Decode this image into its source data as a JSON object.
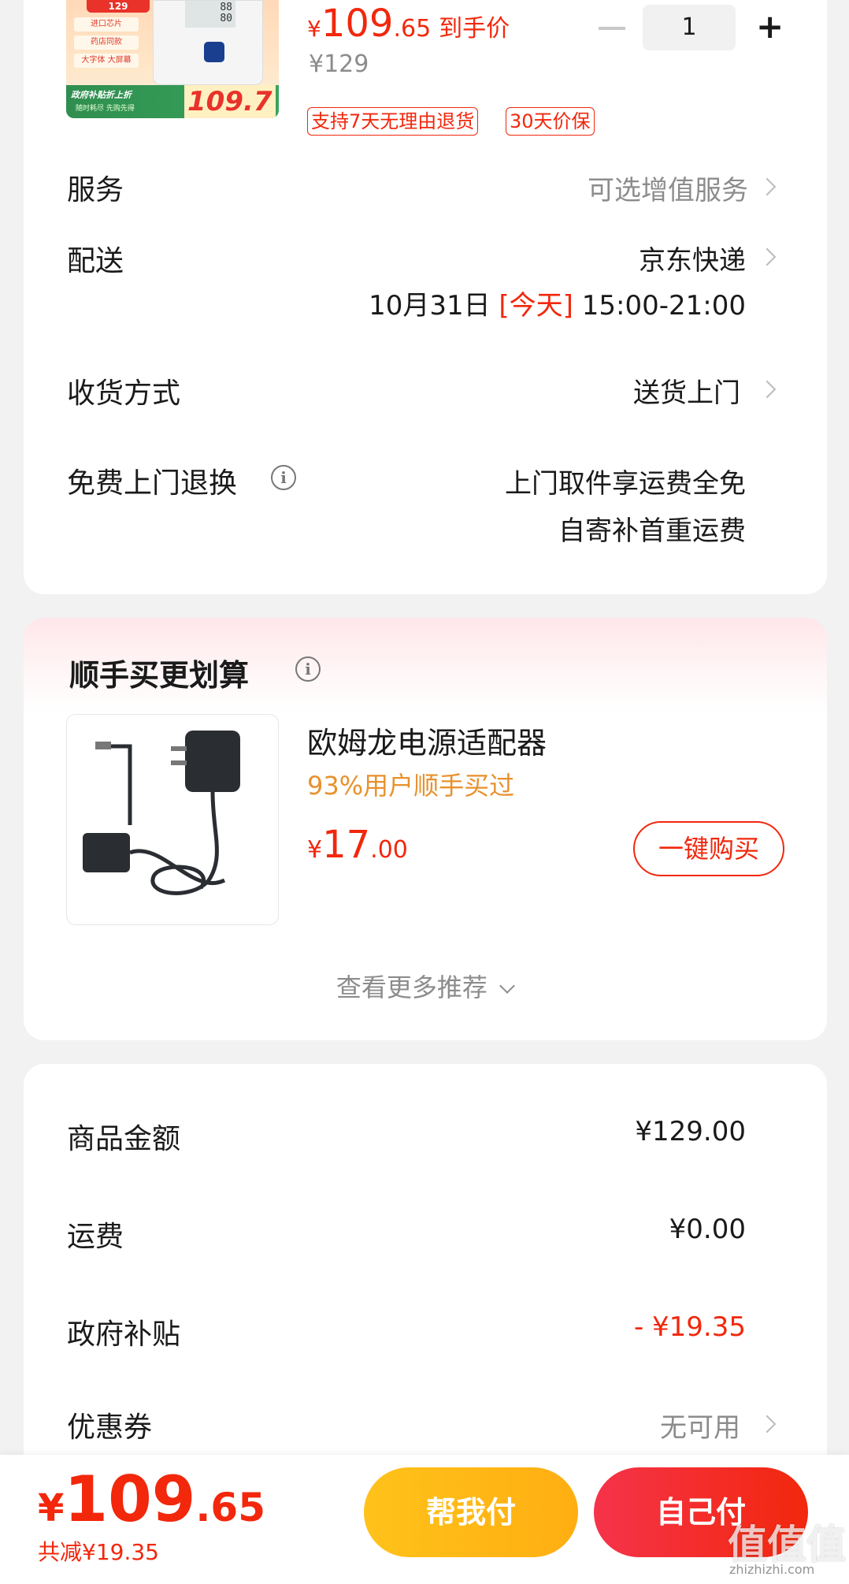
{
  "product": {
    "img_banner_text": "政府补贴折上折",
    "img_banner_sub": "随时耗尽 先购先得",
    "img_banner_price": "109.7",
    "img_top_tag": "129",
    "img_chips": [
      "进口芯片",
      "药店同款",
      "大字体 大屏幕"
    ],
    "img_screen": "88\n80",
    "price_yen": "¥",
    "price_int": "109",
    "price_dec": ".65",
    "price_label": "到手价",
    "original_price": "¥129",
    "quantity": "1",
    "tags": [
      "支持7天无理由退货",
      "30天价保"
    ]
  },
  "rows": {
    "service_label": "服务",
    "service_value": "可选增值服务",
    "delivery_label": "配送",
    "delivery_value": "京东快递",
    "delivery_date": "10月31日",
    "delivery_today": "[今天]",
    "delivery_time": "15:00-21:00",
    "receive_label": "收货方式",
    "receive_value": "送货上门",
    "return_label": "免费上门退换",
    "return_info_icon": "i",
    "return_value_1": "上门取件享运费全免",
    "return_value_2": "自寄补首重运费"
  },
  "recommend": {
    "title": "顺手买更划算",
    "title_info_icon": "i",
    "item_name": "欧姆龙电源适配器",
    "item_sub": "93%用户顺手买过",
    "price_yen": "¥",
    "price_int": "17",
    "price_dec": ".00",
    "buy_label": "一键购买",
    "more_label": "查看更多推荐"
  },
  "summary": {
    "goods_label": "商品金额",
    "goods_value": "¥129.00",
    "shipping_label": "运费",
    "shipping_value": "¥0.00",
    "subsidy_label": "政府补贴",
    "subsidy_value": "- ¥19.35",
    "coupon_label": "优惠券",
    "coupon_value": "无可用"
  },
  "bottom": {
    "total_yen": "¥",
    "total_int": "109",
    "total_dec": ".65",
    "saved": "共减¥19.35",
    "help_pay": "帮我付",
    "self_pay": "自己付",
    "watermark": "值值值",
    "watermark_sub": "zhizhizhi.com"
  },
  "colors": {
    "accent_red": "#f2270c",
    "orange_text": "#e8912d",
    "yellow_button": "#ffb718"
  }
}
